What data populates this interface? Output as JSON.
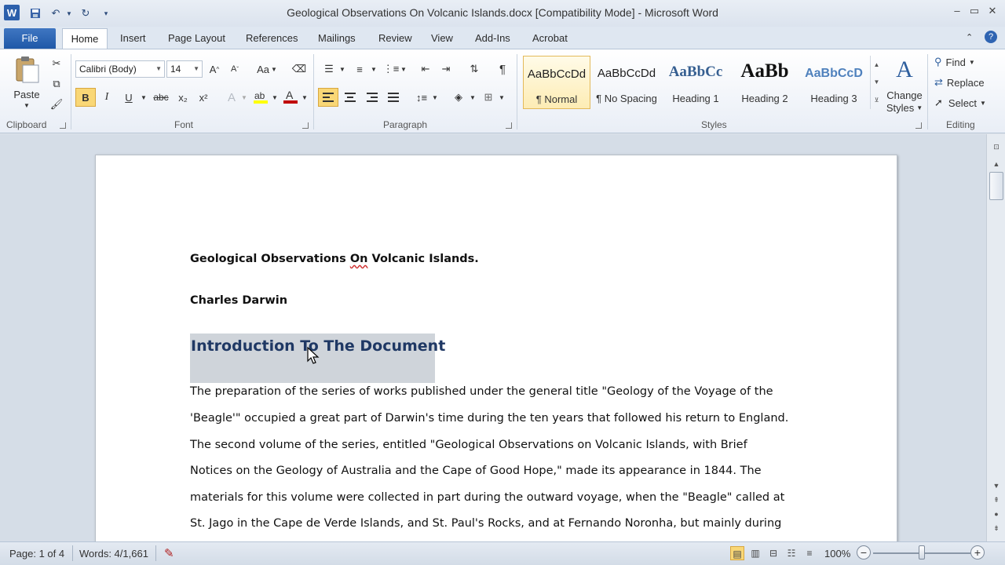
{
  "window": {
    "title": "Geological Observations On Volcanic Islands.docx [Compatibility Mode] - Microsoft Word",
    "app_icon": "W"
  },
  "tabs": [
    "File",
    "Home",
    "Insert",
    "Page Layout",
    "References",
    "Mailings",
    "Review",
    "View",
    "Add-Ins",
    "Acrobat"
  ],
  "clipboard": {
    "paste": "Paste",
    "group": "Clipboard"
  },
  "font": {
    "name": "Calibri (Body)",
    "size": "14",
    "group": "Font",
    "bold": "B",
    "italic": "I",
    "underline": "U",
    "strike": "abc",
    "sub": "x₂",
    "sup": "x²",
    "grow": "A",
    "shrink": "A",
    "change_case": "Aa",
    "color_letter": "A"
  },
  "paragraph": {
    "group": "Paragraph",
    "pilcrow": "¶"
  },
  "styles": {
    "group": "Styles",
    "items": [
      {
        "sample": "AaBbCcDd",
        "name": "¶ Normal"
      },
      {
        "sample": "AaBbCcDd",
        "name": "¶ No Spacing"
      },
      {
        "sample": "AaBbCc",
        "name": "Heading 1"
      },
      {
        "sample": "AaBb",
        "name": "Heading 2"
      },
      {
        "sample": "AaBbCcD",
        "name": "Heading 3"
      }
    ],
    "change_styles_1": "Change",
    "change_styles_2": "Styles"
  },
  "editing": {
    "group": "Editing",
    "find": "Find",
    "replace": "Replace",
    "select": "Select"
  },
  "document": {
    "title_line": "Geological Observations On Volcanic Islands.",
    "author": "Charles Darwin",
    "heading": "Introduction To The Document",
    "paragraph_lines": [
      "The preparation of the series of works published under the general title \"Geology of the Voyage of the",
      "'Beagle'\" occupied a great part of Darwin's time during the ten years that followed his return to England.",
      "The second volume of the series, entitled \"Geological Observations on Volcanic Islands, with Brief",
      "Notices on the Geology of Australia and the Cape of Good Hope,\" made its appearance in 1844. The",
      "materials for this volume were collected in part during the outward voyage, when the \"Beagle\" called at",
      "St. Jago in the Cape de Verde Islands, and St. Paul's Rocks, and at Fernando Noronha, but mainly during"
    ]
  },
  "status": {
    "page": "Page: 1 of 4",
    "words": "Words: 4/1,661",
    "zoom": "100%",
    "zoom_level_fraction": 0.5
  },
  "colors": {
    "file_tab": "#2b62b0",
    "highlight": "#ffff00",
    "font_color": "#c00000",
    "heading": "#1f3864"
  }
}
